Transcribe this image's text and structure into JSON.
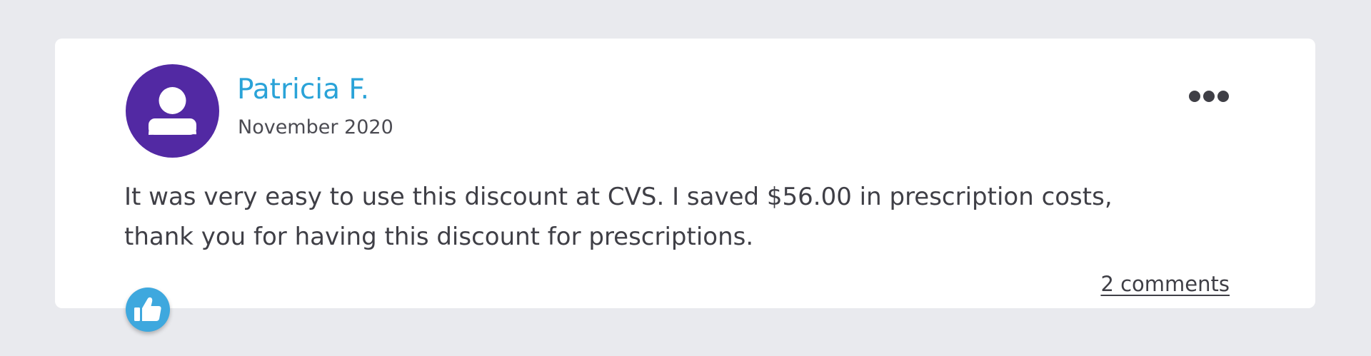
{
  "review": {
    "author_name": "Patricia F.",
    "date": "November 2020",
    "text": "It was very easy to use this discount at CVS. I saved $56.00 in prescription costs, thank you for having this discount for prescriptions.",
    "comments_link": "2 comments"
  },
  "icons": {
    "avatar": "user-icon",
    "more": "more-options-icon",
    "like": "thumbs-up-icon"
  },
  "colors": {
    "page_background": "#e9eaee",
    "card_background": "#ffffff",
    "avatar_background": "#5229a3",
    "author_name": "#2aa3d8",
    "like_button": "#3ea8de",
    "text": "#3f3f46"
  }
}
